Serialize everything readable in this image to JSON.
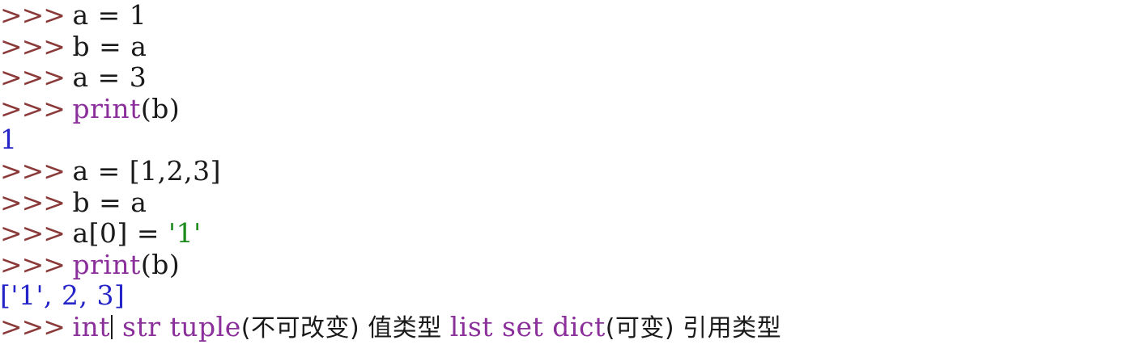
{
  "prompt": ">>> ",
  "lines": [
    {
      "prompt": true,
      "segments": [
        {
          "cls": "code",
          "text": "a = 1"
        }
      ]
    },
    {
      "prompt": true,
      "segments": [
        {
          "cls": "code",
          "text": "b = a"
        }
      ]
    },
    {
      "prompt": true,
      "segments": [
        {
          "cls": "code",
          "text": "a = 3"
        }
      ]
    },
    {
      "prompt": true,
      "segments": [
        {
          "cls": "kw",
          "text": "print"
        },
        {
          "cls": "code",
          "text": "(b)"
        }
      ]
    },
    {
      "prompt": false,
      "segments": [
        {
          "cls": "out",
          "text": "1"
        }
      ]
    },
    {
      "prompt": true,
      "segments": [
        {
          "cls": "code",
          "text": "a = [1,2,3]"
        }
      ]
    },
    {
      "prompt": true,
      "segments": [
        {
          "cls": "code",
          "text": "b = a"
        }
      ]
    },
    {
      "prompt": true,
      "segments": [
        {
          "cls": "code",
          "text": "a[0] = "
        },
        {
          "cls": "str",
          "text": "'1'"
        }
      ]
    },
    {
      "prompt": true,
      "segments": [
        {
          "cls": "kw",
          "text": "print"
        },
        {
          "cls": "code",
          "text": "(b)"
        }
      ]
    },
    {
      "prompt": false,
      "segments": [
        {
          "cls": "out",
          "text": "['1', 2, 3]"
        }
      ]
    },
    {
      "prompt": true,
      "cursor_after": 0,
      "segments": [
        {
          "cls": "kw",
          "text": "int"
        },
        {
          "cls": "code",
          "text": " "
        },
        {
          "cls": "kw",
          "text": "str"
        },
        {
          "cls": "code",
          "text": " "
        },
        {
          "cls": "kw",
          "text": "tuple"
        },
        {
          "cls": "cjk",
          "text": "(不可改变) 值类型 "
        },
        {
          "cls": "kw",
          "text": "list"
        },
        {
          "cls": "code",
          "text": " "
        },
        {
          "cls": "kw",
          "text": "set"
        },
        {
          "cls": "code",
          "text": " "
        },
        {
          "cls": "kw",
          "text": "dict"
        },
        {
          "cls": "cjk",
          "text": "(可变) 引用类型"
        }
      ]
    }
  ]
}
